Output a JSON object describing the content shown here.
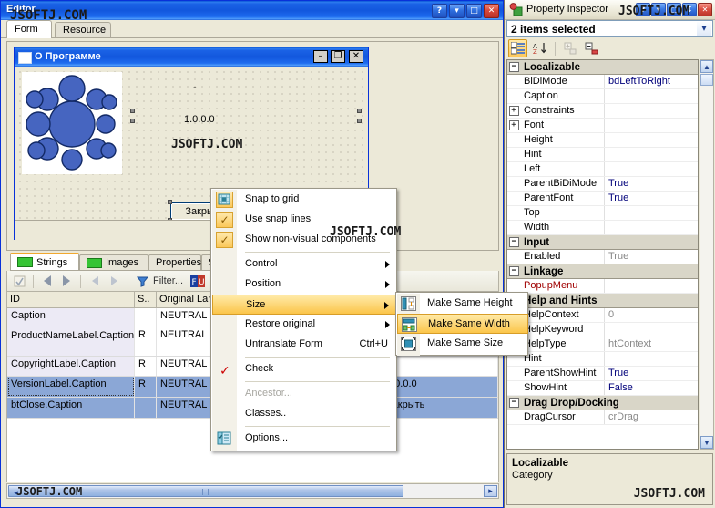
{
  "watermark": "JSOFTJ.COM",
  "editor": {
    "title": "Editor",
    "window_buttons": [
      {
        "name": "help-button",
        "glyph": "?"
      },
      {
        "name": "minimize-button",
        "glyph": "▾"
      },
      {
        "name": "maximize-button",
        "glyph": "□"
      },
      {
        "name": "close-button",
        "glyph": "✕"
      }
    ],
    "tabs": [
      {
        "label": "Form",
        "active": true
      },
      {
        "label": "Resource",
        "active": false
      }
    ]
  },
  "designer": {
    "form": {
      "title": "О Программе",
      "buttons": [
        {
          "name": "form-minimize-button",
          "glyph": "–"
        },
        {
          "name": "form-maximize-button",
          "glyph": "❐"
        },
        {
          "name": "form-close-button",
          "glyph": "✕"
        }
      ],
      "product_name_label": "-",
      "version_label": "1.0.0.0",
      "copyright_label": "·",
      "close_button_label": "Закрыть"
    }
  },
  "bottom_panel": {
    "tabs": [
      {
        "label": "Strings",
        "active": true,
        "icon": "green-box-icon"
      },
      {
        "label": "Images",
        "active": false,
        "icon": "green-box-icon"
      },
      {
        "label": "Properties",
        "active": false,
        "icon": null
      },
      {
        "label": "Stati",
        "active": false,
        "icon": null
      }
    ],
    "toolbar": {
      "validate_icon": "validate-icon",
      "prev_icon": "arrow-left-icon",
      "next_icon": "arrow-right-icon",
      "prev_untranslated_icon": "arrow-left-disabled-icon",
      "next_untranslated_icon": "arrow-right-disabled-icon",
      "filter_icon": "funnel-icon",
      "filter_label": "Filter...",
      "flags_icon": "flags-icon"
    },
    "grid": {
      "columns": [
        "ID",
        "S..",
        "Original Langu...",
        "",
        "",
        ""
      ],
      "rows": [
        {
          "id": "Caption",
          "s": "",
          "orig": "NEUTRAL",
          "v1": "",
          "v2": "",
          "selected": false
        },
        {
          "id": "ProductNameLabel.Caption",
          "s": "R",
          "orig": "NEUTRAL",
          "v1": "",
          "v2": "",
          "selected": false
        },
        {
          "id": "CopyrightLabel.Caption",
          "s": "R",
          "orig": "NEUTRAL",
          "v1": "",
          "v2": "",
          "selected": false
        },
        {
          "id": "VersionLabel.Caption",
          "s": "R",
          "orig": "NEUTRAL",
          "v1": "",
          "v2": "1.0.0.0",
          "selected": true
        },
        {
          "id": "btClose.Caption",
          "s": "",
          "orig": "NEUTRAL",
          "v1": "",
          "v2": "Закрыть",
          "selected": true
        }
      ]
    },
    "hscroll": {
      "left_glyph": "◂",
      "right_glyph": "▸"
    }
  },
  "context_menu": {
    "items": [
      {
        "label": "Snap to grid",
        "type": "toggle",
        "icon": "snap-to-grid-icon",
        "checked": true,
        "pressed": true
      },
      {
        "label": "Use snap lines",
        "type": "toggle",
        "icon": "check-icon",
        "checked": true
      },
      {
        "label": "Show non-visual components",
        "type": "toggle",
        "icon": "check-icon",
        "checked": true
      },
      {
        "type": "separator"
      },
      {
        "label": "Control",
        "type": "submenu"
      },
      {
        "label": "Position",
        "type": "submenu"
      },
      {
        "label": "Size",
        "type": "submenu",
        "highlighted": true
      },
      {
        "label": "Restore original",
        "type": "submenu"
      },
      {
        "label": "Untranslate Form",
        "type": "item",
        "accel": "Ctrl+U"
      },
      {
        "type": "separator"
      },
      {
        "label": "Check",
        "type": "item",
        "icon": "red-check-icon",
        "checked": true
      },
      {
        "type": "separator"
      },
      {
        "label": "Ancestor...",
        "type": "item",
        "disabled": true
      },
      {
        "label": "Classes..",
        "type": "item"
      },
      {
        "type": "separator"
      },
      {
        "label": "Options...",
        "type": "item",
        "icon": "options-icon"
      }
    ]
  },
  "submenu": {
    "items": [
      {
        "label": "Make Same Height",
        "icon": "same-height-icon",
        "highlighted": false
      },
      {
        "label": "Make Same Width",
        "icon": "same-width-icon",
        "highlighted": true
      },
      {
        "label": "Make Same Size",
        "icon": "same-size-icon",
        "highlighted": false
      }
    ]
  },
  "property_inspector": {
    "title": "Property Inspector",
    "window_buttons": [
      {
        "name": "pi-help-button",
        "glyph": "?"
      },
      {
        "name": "pi-minimize-button",
        "glyph": "▾"
      },
      {
        "name": "pi-maximize-button",
        "glyph": "□"
      },
      {
        "name": "pi-pin-button",
        "glyph": "↧"
      },
      {
        "name": "pi-close-button",
        "glyph": "✕"
      }
    ],
    "selection": "2 items selected",
    "toolbar": [
      {
        "name": "categorized-view-button",
        "icon": "categorized-icon",
        "active": true
      },
      {
        "name": "alphabetical-view-button",
        "icon": "sort-az-icon",
        "active": false
      },
      {
        "name": "expand-all-button",
        "icon": "expand-icon",
        "active": false
      },
      {
        "name": "collapse-all-button",
        "icon": "collapse-icon",
        "active": false
      }
    ],
    "categories": [
      {
        "name": "Localizable",
        "expanded": true,
        "properties": [
          {
            "name": "BiDiMode",
            "value": "bdLeftToRight",
            "expander": false,
            "style": "normal"
          },
          {
            "name": "Caption",
            "value": "",
            "expander": false,
            "style": "normal"
          },
          {
            "name": "Constraints",
            "value": "",
            "expander": true,
            "style": "normal"
          },
          {
            "name": "Font",
            "value": "",
            "expander": true,
            "style": "normal"
          },
          {
            "name": "Height",
            "value": "",
            "expander": false,
            "style": "normal"
          },
          {
            "name": "Hint",
            "value": "",
            "expander": false,
            "style": "normal"
          },
          {
            "name": "Left",
            "value": "",
            "expander": false,
            "style": "normal"
          },
          {
            "name": "ParentBiDiMode",
            "value": "True",
            "expander": false,
            "style": "normal"
          },
          {
            "name": "ParentFont",
            "value": "True",
            "expander": false,
            "style": "normal"
          },
          {
            "name": "Top",
            "value": "",
            "expander": false,
            "style": "normal"
          },
          {
            "name": "Width",
            "value": "",
            "expander": false,
            "style": "normal"
          }
        ]
      },
      {
        "name": "Input",
        "expanded": true,
        "properties": [
          {
            "name": "Enabled",
            "value": "True",
            "expander": false,
            "style": "gray"
          }
        ]
      },
      {
        "name": "Linkage",
        "expanded": true,
        "properties": [
          {
            "name": "PopupMenu",
            "value": "",
            "expander": false,
            "style": "red"
          }
        ]
      },
      {
        "name": "Help and Hints",
        "expanded": true,
        "properties": [
          {
            "name": "HelpContext",
            "value": "0",
            "expander": false,
            "style": "gray"
          },
          {
            "name": "HelpKeyword",
            "value": "",
            "expander": false,
            "style": "normal"
          },
          {
            "name": "HelpType",
            "value": "htContext",
            "expander": false,
            "style": "gray"
          },
          {
            "name": "Hint",
            "value": "",
            "expander": false,
            "style": "normal"
          },
          {
            "name": "ParentShowHint",
            "value": "True",
            "expander": false,
            "style": "normal"
          },
          {
            "name": "ShowHint",
            "value": "False",
            "expander": false,
            "style": "normal"
          }
        ]
      },
      {
        "name": "Drag Drop/Docking",
        "expanded": true,
        "properties": [
          {
            "name": "DragCursor",
            "value": "crDrag",
            "expander": false,
            "style": "gray"
          }
        ]
      }
    ],
    "description": {
      "title": "Localizable",
      "subtitle": "Category"
    },
    "scroll": {
      "up_glyph": "▲",
      "down_glyph": "▼"
    }
  },
  "colors": {
    "titlebar_blue": "#1257dd",
    "accent_orange": "#fbc54a",
    "selection_blue": "#8ba7d6",
    "category_gray": "#d9d6c8",
    "panel_beige": "#ece9d8"
  }
}
